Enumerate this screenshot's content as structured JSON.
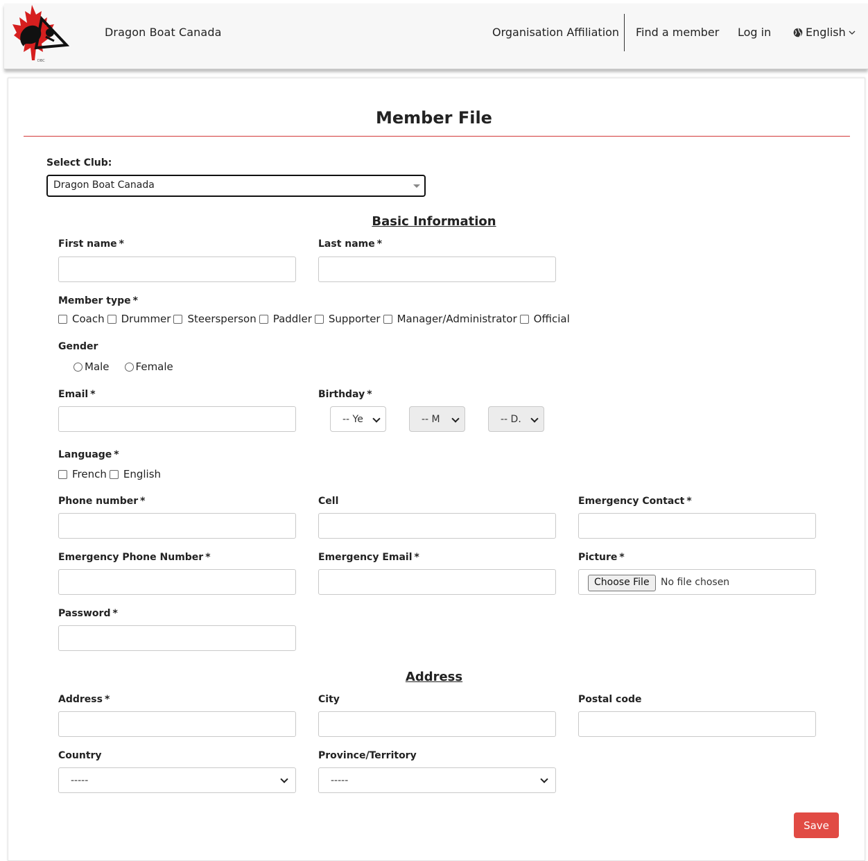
{
  "header": {
    "brand": "Dragon Boat Canada",
    "nav": {
      "affiliation": "Organisation Affiliation",
      "find_member": "Find a member",
      "login": "Log in",
      "language": "English"
    }
  },
  "page": {
    "title": "Member File"
  },
  "club": {
    "label": "Select Club:",
    "value": "Dragon Boat Canada"
  },
  "sections": {
    "basic": "Basic Information",
    "address": "Address"
  },
  "fields": {
    "first_name": "First name",
    "last_name": "Last name",
    "member_type": "Member type",
    "gender": "Gender",
    "email": "Email",
    "birthday": "Birthday",
    "language": "Language",
    "phone": "Phone number",
    "cell": "Cell",
    "emergency_contact": "Emergency Contact",
    "emergency_phone": "Emergency Phone Number",
    "emergency_email": "Emergency Email",
    "picture": "Picture",
    "password": "Password",
    "address": "Address",
    "city": "City",
    "postal_code": "Postal code",
    "country": "Country",
    "province": "Province/Territory"
  },
  "required_mark": "*",
  "member_types": [
    "Coach",
    "Drummer",
    "Steersperson",
    "Paddler",
    "Supporter",
    "Manager/Administrator",
    "Official"
  ],
  "genders": [
    "Male",
    "Female"
  ],
  "languages": [
    "French",
    "English"
  ],
  "birthday_selects": {
    "year": "-- Ye",
    "month": "-- M",
    "day": "-- D."
  },
  "file": {
    "button": "Choose File",
    "status": "No file chosen"
  },
  "country_value": "-----",
  "province_value": "-----",
  "save": "Save",
  "colors": {
    "accent": "#e14b44",
    "rule": "#d23838",
    "header_bg": "#f7f7f7"
  }
}
